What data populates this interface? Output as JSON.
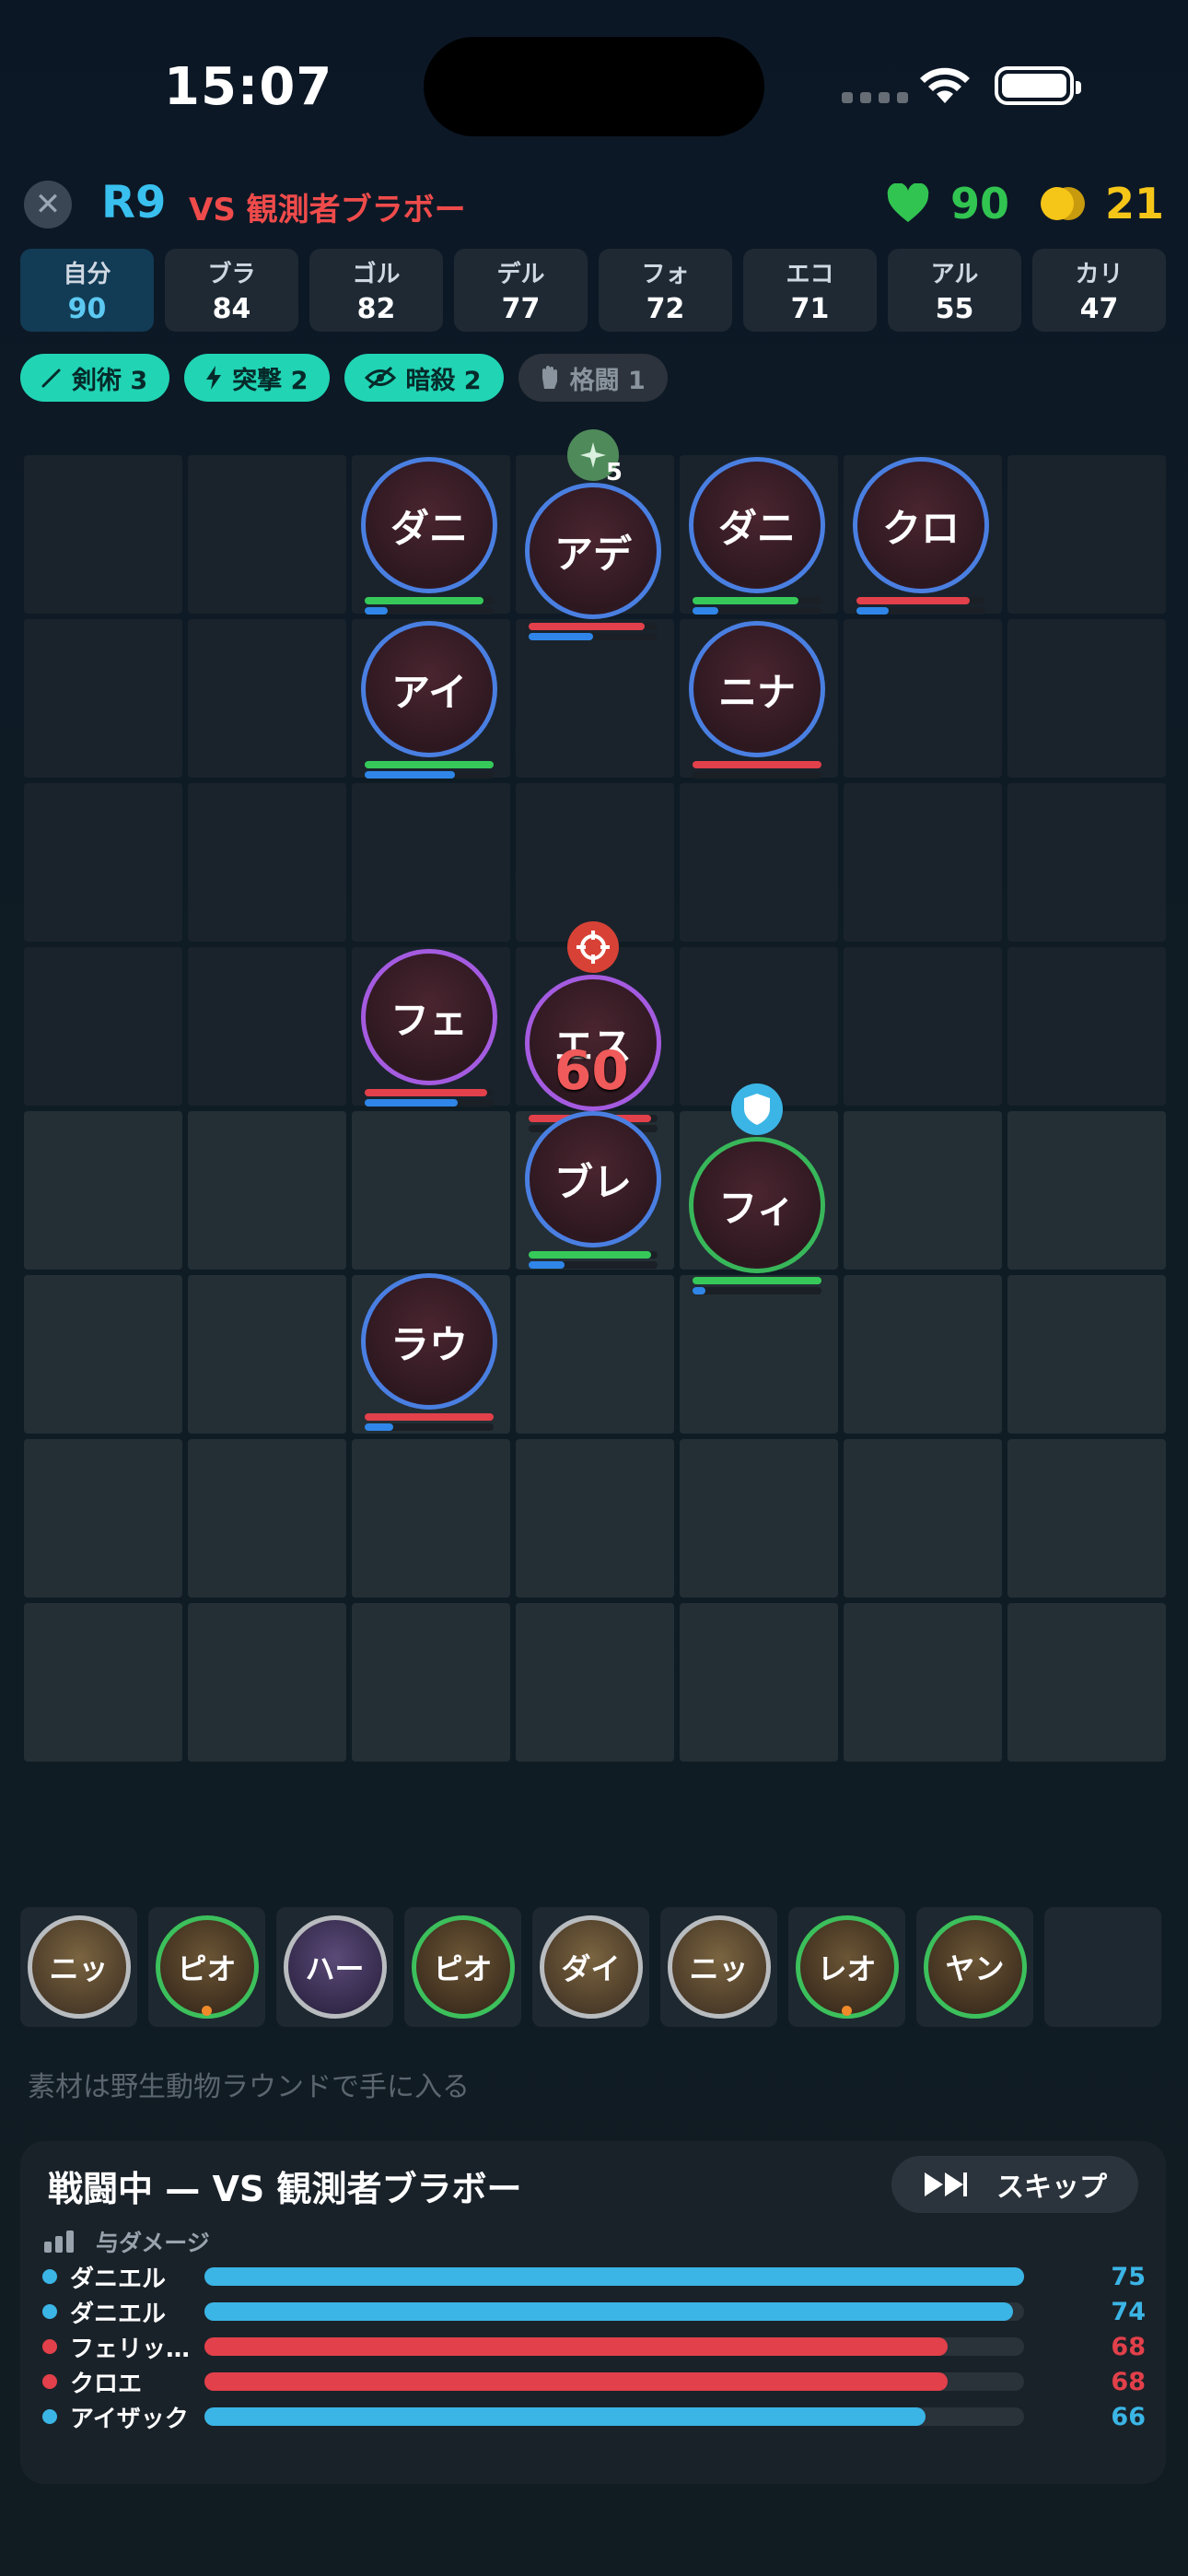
{
  "status": {
    "time": "15:07"
  },
  "header": {
    "round": "R9",
    "opponent": "VS 観測者ブラボー",
    "health": "90",
    "gold": "21",
    "colors": {
      "accent": "#39c0ef",
      "enemy": "#ef4b4b",
      "health": "#31c451",
      "gold": "#f5c518"
    }
  },
  "scores": [
    {
      "name": "自分",
      "value": "90"
    },
    {
      "name": "ブラ",
      "value": "84"
    },
    {
      "name": "ゴル",
      "value": "82"
    },
    {
      "name": "デル",
      "value": "77"
    },
    {
      "name": "フォ",
      "value": "72"
    },
    {
      "name": "エコ",
      "value": "71"
    },
    {
      "name": "アル",
      "value": "55"
    },
    {
      "name": "カリ",
      "value": "47"
    }
  ],
  "traits": [
    {
      "label": "剣術 3",
      "icon": "sword-icon",
      "active": true
    },
    {
      "label": "突撃 2",
      "icon": "lightning-icon",
      "active": true
    },
    {
      "label": "暗殺 2",
      "icon": "eye-slash-icon",
      "active": true
    },
    {
      "label": "格闘 1",
      "icon": "fist-icon",
      "active": false
    }
  ],
  "board": {
    "units": [
      {
        "name": "ダニ",
        "ring": "blue",
        "hp": 0.92,
        "mana": 0.18,
        "hp_color": "green"
      },
      {
        "name": "アデ",
        "ring": "blue",
        "hp": 0.9,
        "mana": 0.5,
        "hp_color": "red",
        "badge": "sparkle-icon",
        "badge_count": "5"
      },
      {
        "name": "ダニ",
        "ring": "blue",
        "hp": 0.82,
        "mana": 0.2,
        "hp_color": "green"
      },
      {
        "name": "クロ",
        "ring": "blue",
        "hp": 0.88,
        "mana": 0.25,
        "hp_color": "red"
      },
      {
        "name": "アイ",
        "ring": "blue",
        "hp": 1.0,
        "mana": 0.7,
        "hp_color": "green"
      },
      {
        "name": "ニナ",
        "ring": "blue",
        "hp": 1.0,
        "mana": 0.0,
        "hp_color": "red"
      },
      {
        "name": "フェ",
        "ring": "purple",
        "hp": 0.95,
        "mana": 0.72,
        "hp_color": "red"
      },
      {
        "name": "エス",
        "ring": "purple",
        "hp": 0.95,
        "mana": 0.0,
        "hp_color": "red",
        "badge": "target-icon",
        "damage": "60"
      },
      {
        "name": "ブレ",
        "ring": "blue",
        "hp": 0.95,
        "mana": 0.28,
        "hp_color": "green"
      },
      {
        "name": "フィ",
        "ring": "green",
        "hp": 1.0,
        "mana": 0.1,
        "hp_color": "green",
        "badge": "shield-icon"
      },
      {
        "name": "ラウ",
        "ring": "blue",
        "hp": 1.0,
        "mana": 0.22,
        "hp_color": "red"
      }
    ]
  },
  "bench": [
    {
      "name": "ニッ",
      "ring": "gray"
    },
    {
      "name": "ピオ",
      "ring": "green",
      "dot": true
    },
    {
      "name": "ハー",
      "ring": "gray"
    },
    {
      "name": "ピオ",
      "ring": "green"
    },
    {
      "name": "ダイ",
      "ring": "gray"
    },
    {
      "name": "ニッ",
      "ring": "gray"
    },
    {
      "name": "レオ",
      "ring": "green",
      "dot": true
    },
    {
      "name": "ヤン",
      "ring": "green"
    }
  ],
  "hint": "素材は野生動物ラウンドで手に入る",
  "battle": {
    "title": "戦闘中 — VS 観測者ブラボー",
    "skip_label": "スキップ",
    "damage_header": "与ダメージ",
    "rows": [
      {
        "name": "ダニエル",
        "value": 75,
        "team": "ally"
      },
      {
        "name": "ダニエル",
        "value": 74,
        "team": "ally"
      },
      {
        "name": "フェリッ…",
        "value": 68,
        "team": "enemy"
      },
      {
        "name": "クロエ",
        "value": 68,
        "team": "enemy"
      },
      {
        "name": "アイザック",
        "value": 66,
        "team": "ally"
      }
    ],
    "max": 75
  }
}
